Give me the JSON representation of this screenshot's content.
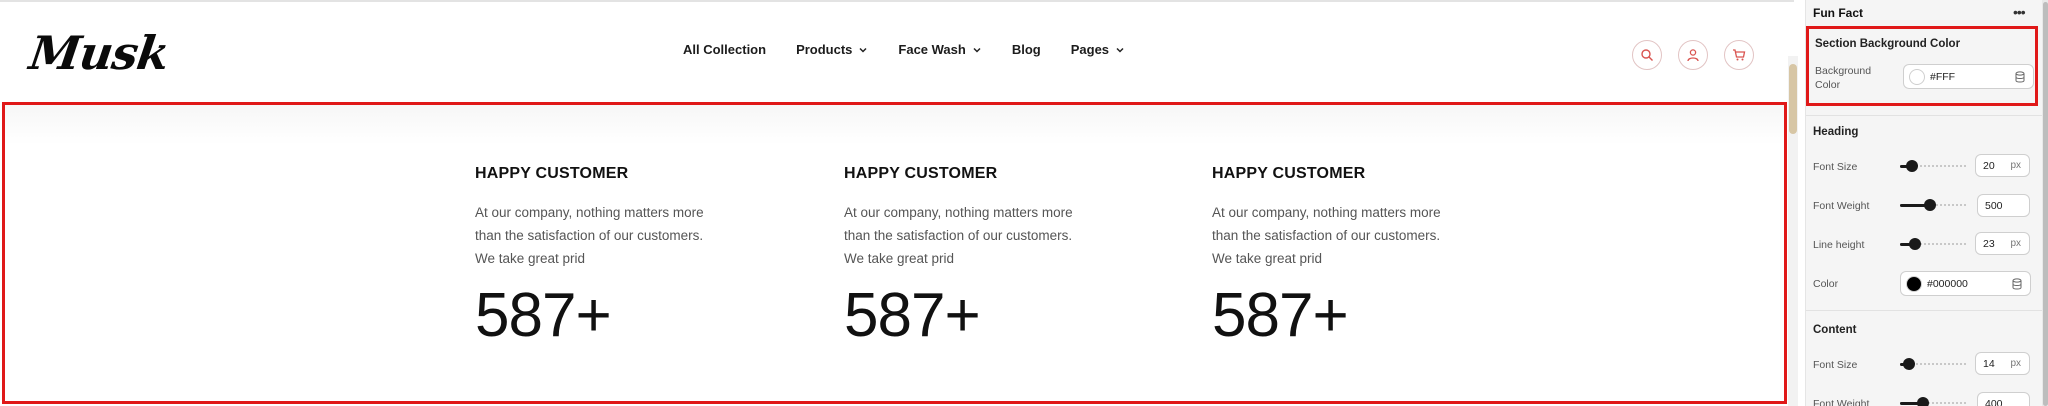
{
  "site": {
    "logo": "Musk",
    "nav": [
      {
        "label": "All Collection",
        "dropdown": false
      },
      {
        "label": "Products",
        "dropdown": true
      },
      {
        "label": "Face Wash",
        "dropdown": true
      },
      {
        "label": "Blog",
        "dropdown": false
      },
      {
        "label": "Pages",
        "dropdown": true
      }
    ],
    "icons": [
      "search-icon",
      "user-icon",
      "cart-icon"
    ],
    "accent_color": "#d9534f"
  },
  "fun_fact": {
    "cards": [
      {
        "title": "HAPPY CUSTOMER",
        "description": "At our company, nothing matters more than the satisfaction of our customers. We take great prid",
        "number": "587+"
      },
      {
        "title": "HAPPY CUSTOMER",
        "description": "At our company, nothing matters more than the satisfaction of our customers. We take great prid",
        "number": "587+"
      },
      {
        "title": "HAPPY CUSTOMER",
        "description": "At our company, nothing matters more than the satisfaction of our customers. We take great prid",
        "number": "587+"
      }
    ],
    "highlight_color": "#e01818"
  },
  "panel": {
    "title": "Fun Fact",
    "more_icon": "more-horizontal-icon",
    "section_bg": {
      "title": "Section Background Color",
      "bg_label": "Background Color",
      "bg_value": "#FFF",
      "swatch_color": "#ffffff"
    },
    "heading": {
      "title": "Heading",
      "font_size_label": "Font Size",
      "font_size_value": "20",
      "font_size_unit": "px",
      "font_size_level": 0.18,
      "font_weight_label": "Font Weight",
      "font_weight_value": "500",
      "font_weight_level": 0.45,
      "line_height_label": "Line height",
      "line_height_value": "23",
      "line_height_unit": "px",
      "line_height_level": 0.22,
      "color_label": "Color",
      "color_value": "#000000",
      "swatch_color": "#000000"
    },
    "content": {
      "title": "Content",
      "font_size_label": "Font Size",
      "font_size_value": "14",
      "font_size_unit": "px",
      "font_size_level": 0.14,
      "font_weight_label": "Font Weight",
      "font_weight_value": "400",
      "font_weight_level": 0.35
    }
  }
}
